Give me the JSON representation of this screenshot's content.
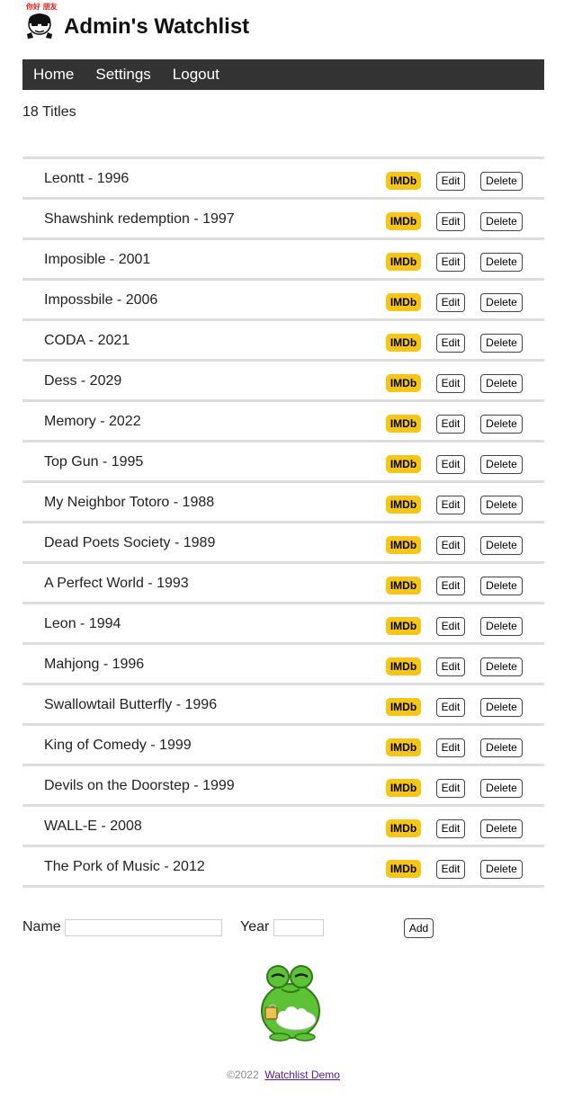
{
  "header": {
    "avatar_caption": "你好 朋友",
    "title": "Admin's Watchlist"
  },
  "nav": {
    "items": [
      "Home",
      "Settings",
      "Logout"
    ]
  },
  "count_text": "18 Titles",
  "movies": [
    {
      "title": "Leontt - 1996"
    },
    {
      "title": "Shawshink redemption - 1997"
    },
    {
      "title": "Imposible - 2001"
    },
    {
      "title": "Impossbile - 2006"
    },
    {
      "title": "CODA - 2021"
    },
    {
      "title": "Dess - 2029"
    },
    {
      "title": "Memory - 2022"
    },
    {
      "title": "Top Gun - 1995"
    },
    {
      "title": "My Neighbor Totoro - 1988"
    },
    {
      "title": "Dead Poets Society - 1989"
    },
    {
      "title": "A Perfect World - 1993"
    },
    {
      "title": "Leon - 1994"
    },
    {
      "title": "Mahjong - 1996"
    },
    {
      "title": "Swallowtail Butterfly - 1996"
    },
    {
      "title": "King of Comedy - 1999"
    },
    {
      "title": "Devils on the Doorstep - 1999"
    },
    {
      "title": "WALL-E - 2008"
    },
    {
      "title": "The Pork of Music - 2012"
    }
  ],
  "row_buttons": {
    "imdb_label": "IMDb",
    "edit_label": "Edit",
    "delete_label": "Delete"
  },
  "form": {
    "name_label": "Name",
    "name_value": "",
    "year_label": "Year",
    "year_value": "",
    "add_label": "Add"
  },
  "footer": {
    "copyright": "©2022",
    "link_text": "Watchlist Demo"
  },
  "colors": {
    "nav_bg": "#333333",
    "imdb_yellow": "#f5c518",
    "row_divider": "#dddddd",
    "link_visited": "#551a8b",
    "mascot_green": "#5dc236"
  }
}
